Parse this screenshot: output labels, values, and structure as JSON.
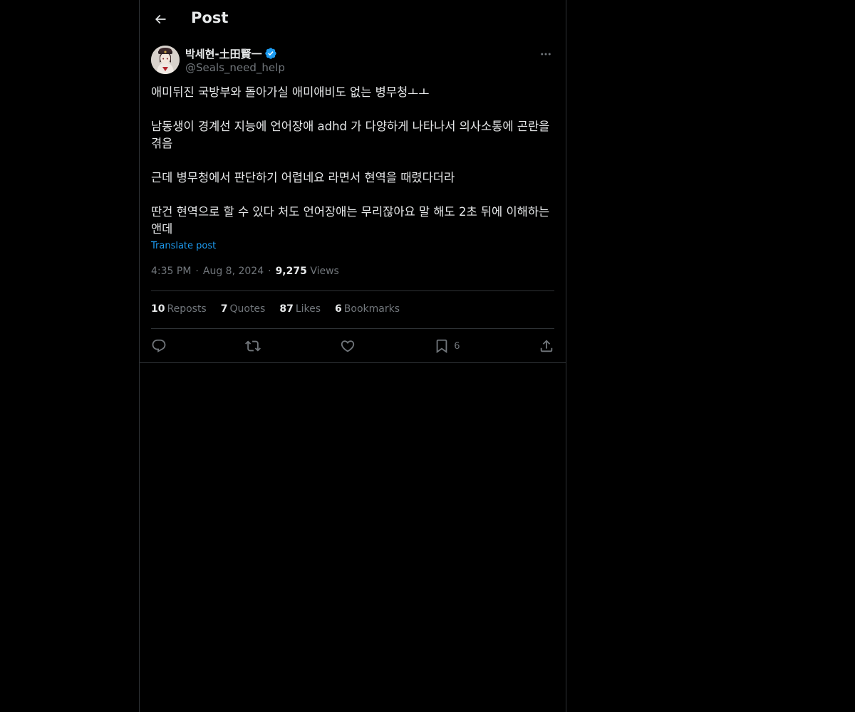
{
  "header": {
    "title": "Post",
    "back_icon": "arrow-left-icon"
  },
  "post": {
    "author": {
      "name": "박세현-土田賢一",
      "handle": "@Seals_need_help",
      "verified": true,
      "verified_color": "#1d9bf0"
    },
    "paragraphs": [
      "애미뒤진 국방부와 돌아가실 애미애비도 없는 병무청ㅗㅗ",
      "남동생이 경계선 지능에 언어장애 adhd 가 다양하게 나타나서 의사소통에 곤란을\n겪음",
      "근데 병무청에서 판단하기 어렵네요 라면서 현역을 때렸다더라",
      "딴건 현역으로 할 수 있다 처도 언어장애는 무리잖아요 말 해도 2초 뒤에 이해하는\n앤데"
    ],
    "translate_label": "Translate post",
    "time": "4:35 PM",
    "date": "Aug 8, 2024",
    "views_count": "9,275",
    "views_label": "Views",
    "separator": "·"
  },
  "stats": {
    "reposts": {
      "count": "10",
      "label": "Reposts"
    },
    "quotes": {
      "count": "7",
      "label": "Quotes"
    },
    "likes": {
      "count": "87",
      "label": "Likes"
    },
    "bookmarks": {
      "count": "6",
      "label": "Bookmarks"
    }
  },
  "actions": {
    "reply_icon": "reply-icon",
    "repost_icon": "repost-icon",
    "like_icon": "heart-icon",
    "bookmark_icon": "bookmark-icon",
    "bookmark_count": "6",
    "share_icon": "share-icon"
  },
  "colors": {
    "background": "#000000",
    "text": "#e7e9ea",
    "secondary": "#71767b",
    "accent": "#1d9bf0",
    "border": "#2f3336"
  }
}
